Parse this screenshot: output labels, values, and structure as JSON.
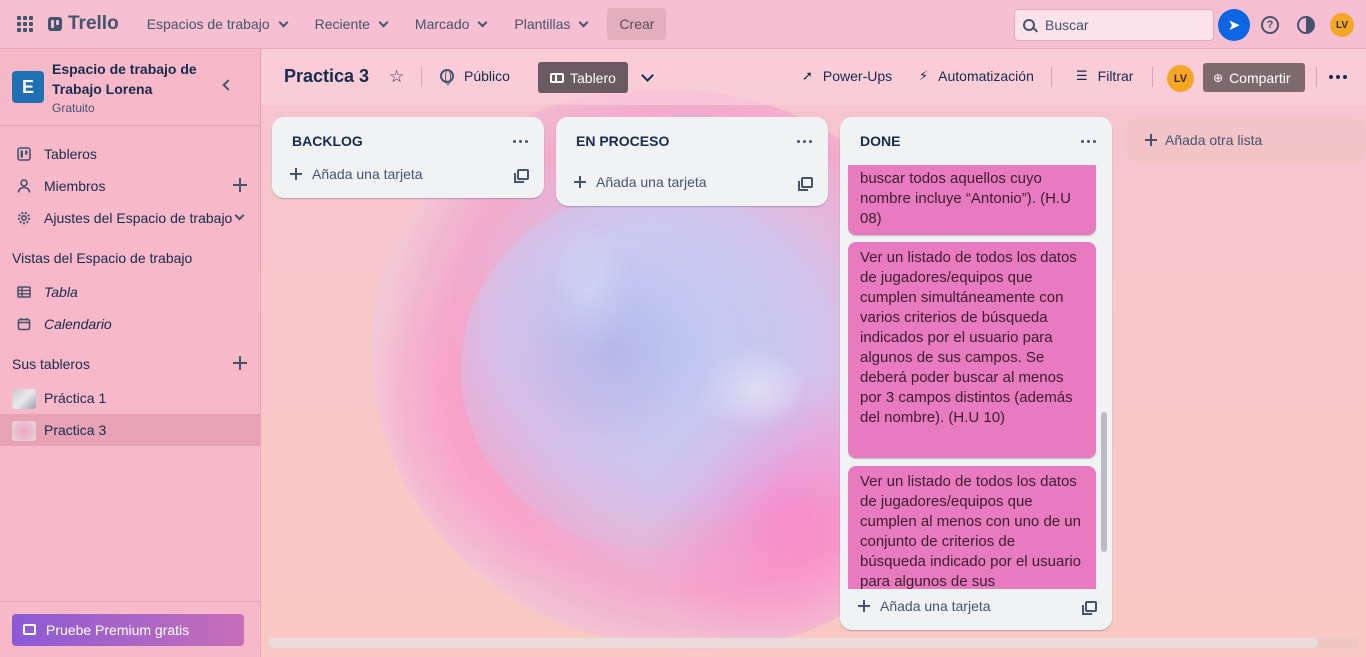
{
  "topbar": {
    "app_name": "Trello",
    "nav": [
      "Espacios de trabajo",
      "Reciente",
      "Marcado",
      "Plantillas"
    ],
    "create_label": "Crear",
    "search_placeholder": "Buscar",
    "avatar_initials": "LV",
    "accent": "#0c66e4"
  },
  "sidebar": {
    "workspace_name": "Espacio de trabajo de Trabajo Lorena",
    "workspace_initial": "E",
    "workspace_plan": "Gratuito",
    "items": [
      {
        "label": "Tableros",
        "icon": "board-icon"
      },
      {
        "label": "Miembros",
        "icon": "person-icon"
      },
      {
        "label": "Ajustes del Espacio de trabajo",
        "icon": "gear-icon"
      }
    ],
    "views_heading": "Vistas del Espacio de trabajo",
    "views": [
      {
        "label": "Tabla",
        "icon": "table-icon"
      },
      {
        "label": "Calendario",
        "icon": "calendar-icon"
      }
    ],
    "boards_heading": "Sus tableros",
    "boards": [
      {
        "label": "Práctica 1"
      },
      {
        "label": "Practica 3",
        "active": true
      }
    ],
    "premium_label": "Pruebe Premium gratis"
  },
  "board": {
    "title": "Practica 3",
    "visibility": "Público",
    "view_label": "Tablero",
    "powerups": "Power-Ups",
    "automation": "Automatización",
    "filter": "Filtrar",
    "member_initials": "LV",
    "share": "Compartir",
    "add_list": "Añada otra lista",
    "add_card": "Añada una tarjeta",
    "card_color": "#e87bbf"
  },
  "lists": [
    {
      "title": "BACKLOG"
    },
    {
      "title": "EN PROCESO"
    },
    {
      "title": "DONE",
      "cards": [
        "buscar todos aquellos cuyo nombre incluye “Antonio”). (H.U 08)",
        "Ver un listado de todos los datos de jugadores/equipos que cumplen simultáneamente con varios criterios de búsqueda indicados por el usuario para algunos de sus campos. Se deberá poder buscar al menos por 3 campos distintos (además del nombre). (H.U 10)",
        "Ver un listado de todos los datos de jugadores/equipos que cumplen al menos con uno de un conjunto de criterios de búsqueda indicado por el usuario para algunos de sus"
      ]
    }
  ]
}
